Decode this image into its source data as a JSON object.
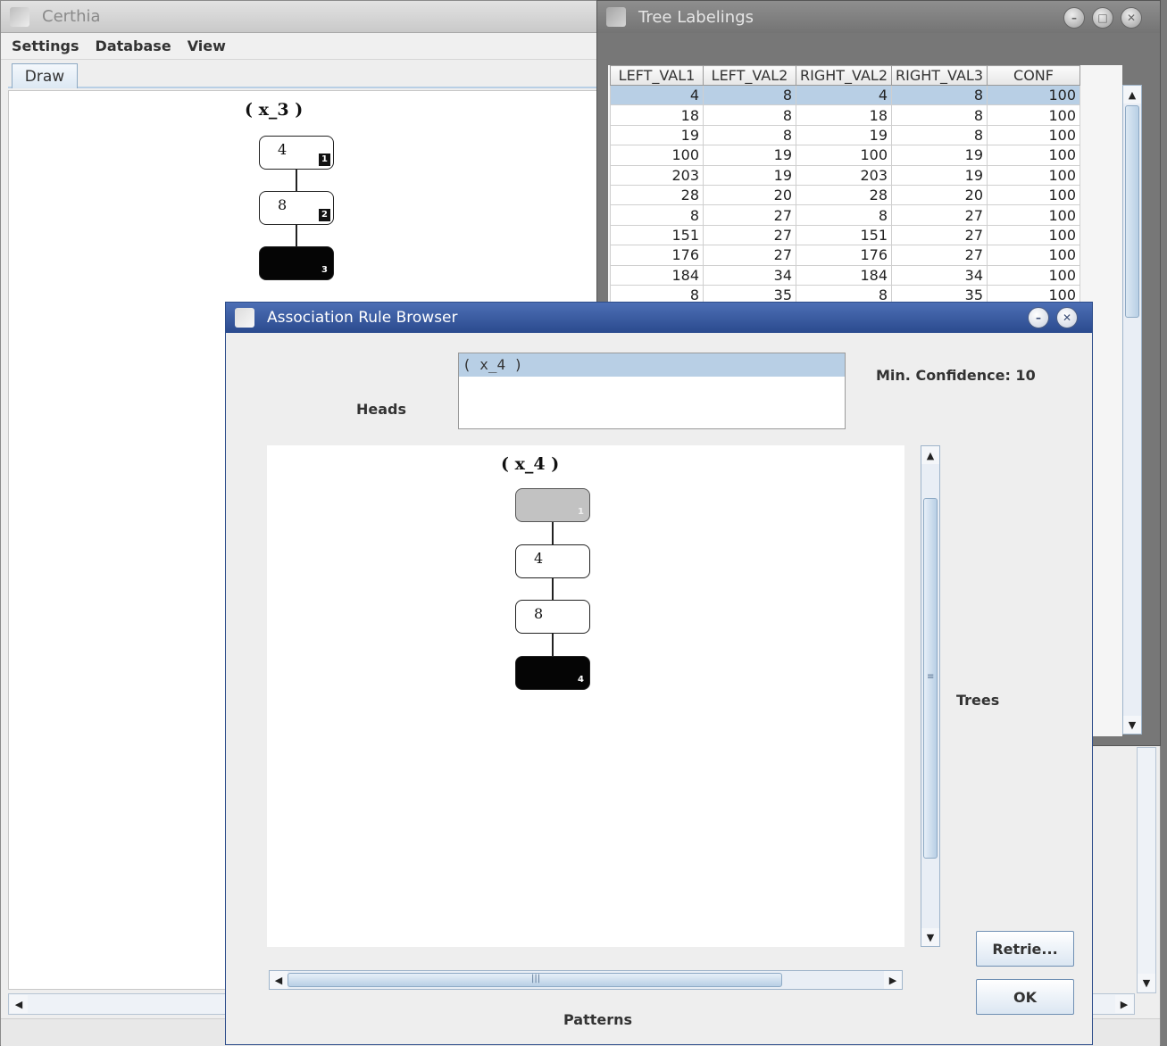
{
  "main_window": {
    "title": "Certhia",
    "menu": [
      "Settings",
      "Database",
      "View"
    ],
    "tab": "Draw",
    "tree": {
      "label": "( x_3 )",
      "nodes": [
        {
          "value": "4",
          "index": "1",
          "style": "white"
        },
        {
          "value": "8",
          "index": "2",
          "style": "white"
        },
        {
          "value": "",
          "index": "3",
          "style": "black"
        }
      ]
    }
  },
  "labelings_window": {
    "title": "Tree Labelings",
    "columns": [
      "LEFT_VAL1",
      "LEFT_VAL2",
      "RIGHT_VAL2",
      "RIGHT_VAL3",
      "CONF"
    ],
    "rows": [
      [
        "4",
        "8",
        "4",
        "8",
        "100"
      ],
      [
        "18",
        "8",
        "18",
        "8",
        "100"
      ],
      [
        "19",
        "8",
        "19",
        "8",
        "100"
      ],
      [
        "100",
        "19",
        "100",
        "19",
        "100"
      ],
      [
        "203",
        "19",
        "203",
        "19",
        "100"
      ],
      [
        "28",
        "20",
        "28",
        "20",
        "100"
      ],
      [
        "8",
        "27",
        "8",
        "27",
        "100"
      ],
      [
        "151",
        "27",
        "151",
        "27",
        "100"
      ],
      [
        "176",
        "27",
        "176",
        "27",
        "100"
      ],
      [
        "184",
        "34",
        "184",
        "34",
        "100"
      ],
      [
        "8",
        "35",
        "8",
        "35",
        "100"
      ]
    ],
    "selected_row": 0
  },
  "rule_browser": {
    "title": "Association Rule Browser",
    "heads_label": "Heads",
    "heads_items": [
      "( x_4 )"
    ],
    "min_confidence": "Min. Confidence: 10",
    "trees_label": "Trees",
    "patterns_label": "Patterns",
    "tree": {
      "label": "( x_4 )",
      "nodes": [
        {
          "value": "",
          "index": "1",
          "style": "gray"
        },
        {
          "value": "4",
          "index": "",
          "style": "white"
        },
        {
          "value": "8",
          "index": "",
          "style": "white"
        },
        {
          "value": "",
          "index": "4",
          "style": "black"
        }
      ]
    },
    "retrieve_button": "Retrie...",
    "ok_button": "OK"
  },
  "colors": {
    "selection": "#b8cfe5",
    "dialog_title": "#2a4a8e"
  }
}
